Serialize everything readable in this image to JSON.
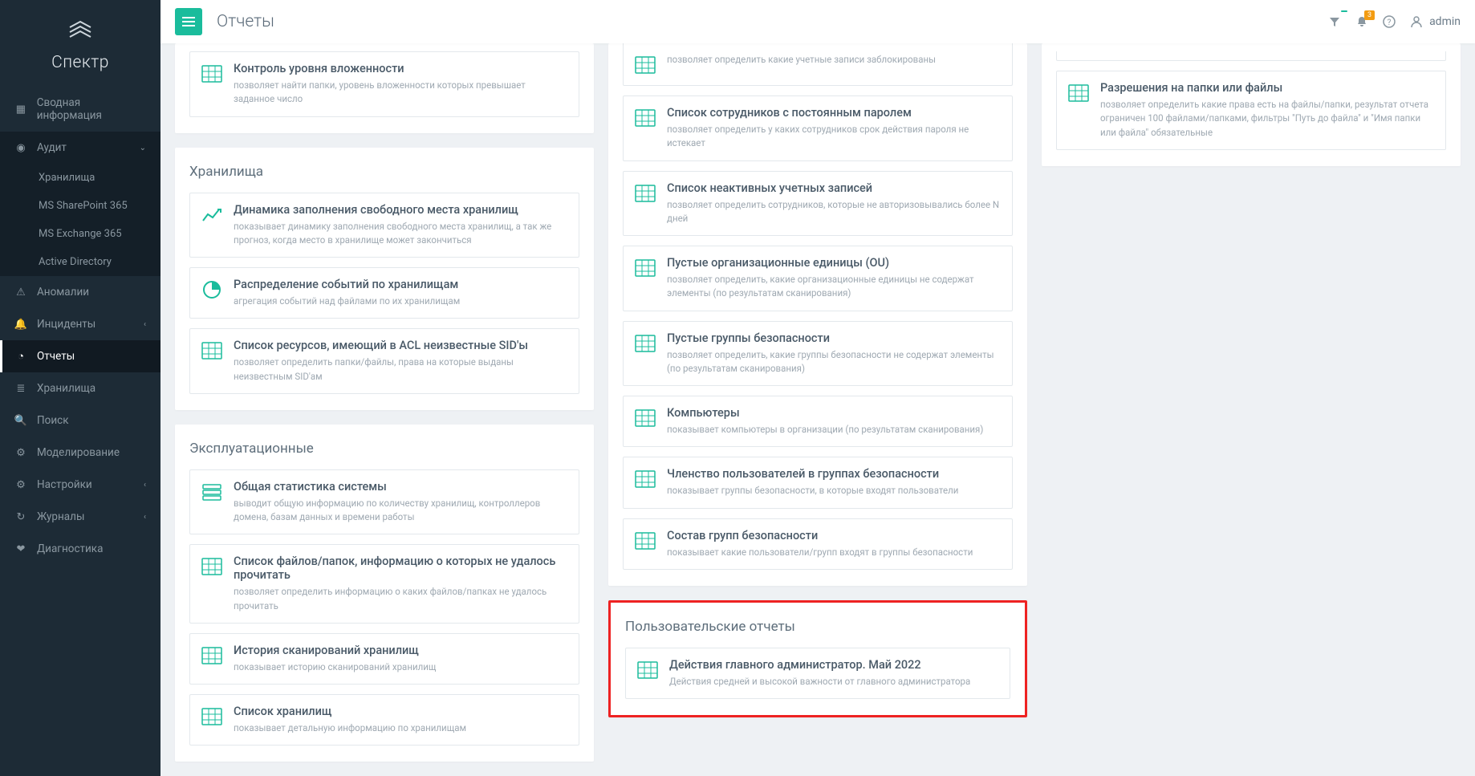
{
  "header": {
    "page_title": "Отчеты",
    "badge1": "",
    "badge2": "3",
    "user": "admin"
  },
  "logo": {
    "text": "Спектр"
  },
  "sidebar": {
    "items": [
      {
        "icon": "dashboard",
        "label": "Сводная информация"
      },
      {
        "icon": "eye",
        "label": "Аудит",
        "expanded": true,
        "children": [
          {
            "label": "Хранилища"
          },
          {
            "label": "MS SharePoint 365"
          },
          {
            "label": "MS Exchange 365"
          },
          {
            "label": "Active Directory"
          }
        ]
      },
      {
        "icon": "warning",
        "label": "Аномалии"
      },
      {
        "icon": "bell",
        "label": "Инциденты",
        "sub": true
      },
      {
        "icon": "pie",
        "label": "Отчеты",
        "active": true
      },
      {
        "icon": "db",
        "label": "Хранилища"
      },
      {
        "icon": "search",
        "label": "Поиск"
      },
      {
        "icon": "settings2",
        "label": "Моделирование"
      },
      {
        "icon": "cogs",
        "label": "Настройки",
        "sub": true
      },
      {
        "icon": "refresh",
        "label": "Журналы",
        "sub": true
      },
      {
        "icon": "heart",
        "label": "Диагностика"
      }
    ]
  },
  "col1": {
    "panel0": {
      "cards": [
        {
          "icon": "grid",
          "title": "Контроль уровня вложенности",
          "desc": "позволяет найти папки, уровень вложенности которых превышает заданное число"
        }
      ]
    },
    "panel1": {
      "title": "Хранилища",
      "cards": [
        {
          "icon": "chart",
          "title": "Динамика заполнения свободного места хранилищ",
          "desc": "показывает динамику заполнения свободного места хранилищ, а так же прогноз, когда место в хранилище может закончиться"
        },
        {
          "icon": "pie",
          "title": "Распределение событий по хранилищам",
          "desc": "агрегация событий над файлами по их хранилищам"
        },
        {
          "icon": "grid",
          "title": "Список ресурсов, имеющий в ACL неизвестные SID'ы",
          "desc": "позволяет определить папки/файлы, права на которые выданы неизвестным SID'ам"
        }
      ]
    },
    "panel2": {
      "title": "Эксплуатационные",
      "cards": [
        {
          "icon": "server",
          "title": "Общая статистика системы",
          "desc": "выводит общую информацию по количеству хранилищ, контроллеров домена, базам данных и времени работы"
        },
        {
          "icon": "grid",
          "title": "Список файлов/папок, информацию о которых не удалось прочитать",
          "desc": "позволяет определить информацию о каких файлов/папках не удалось прочитать"
        },
        {
          "icon": "grid",
          "title": "История сканирований хранилищ",
          "desc": "показывает историю сканирований хранилищ"
        },
        {
          "icon": "grid",
          "title": "Список хранилищ",
          "desc": "показывает детальную информацию по хранилищам"
        }
      ]
    }
  },
  "col2": {
    "panel0": {
      "cards": [
        {
          "icon": "grid",
          "title": "",
          "desc": "позволяет определить какие учетные записи заблокированы"
        },
        {
          "icon": "grid",
          "title": "Список сотрудников с постоянным паролем",
          "desc": "позволяет определить у каких сотрудников срок действия пароля не истекает"
        },
        {
          "icon": "grid",
          "title": "Список неактивных учетных записей",
          "desc": "позволяет определить сотрудников, которые не авторизовывались более N дней"
        },
        {
          "icon": "grid",
          "title": "Пустые организационные единицы (OU)",
          "desc": "позволяет определить, какие организационные единицы не содержат элементы (по результатам сканирования)"
        },
        {
          "icon": "grid",
          "title": "Пустые группы безопасности",
          "desc": "позволяет определить, какие группы безопасности не содержат элементы (по результатам сканирования)"
        },
        {
          "icon": "grid",
          "title": "Компьютеры",
          "desc": "показывает компьютеры в организации (по результатам сканирования)"
        },
        {
          "icon": "grid",
          "title": "Членство пользователей в группах безопасности",
          "desc": "показывает группы безопасности, в которые входят пользователи"
        },
        {
          "icon": "grid",
          "title": "Состав групп безопасности",
          "desc": "показывает какие пользователи/групп входят в группы безопасности"
        }
      ]
    },
    "panel_user": {
      "title": "Пользовательские отчеты",
      "cards": [
        {
          "icon": "grid",
          "title": "Действия главного администратор. Май 2022",
          "desc": "Действия средней и высокой важности от главного администратора"
        }
      ]
    }
  },
  "col3": {
    "panel0": {
      "cards": [
        {
          "icon": "grid",
          "title": "Разрешения на папки или файлы",
          "desc": "позволяет определить какие права есть на файлы/папки, результат отчета ограничен 100 файлами/папками, фильтры \"Путь до файла\" и \"Имя папки или файла\" обязательные"
        }
      ]
    }
  }
}
